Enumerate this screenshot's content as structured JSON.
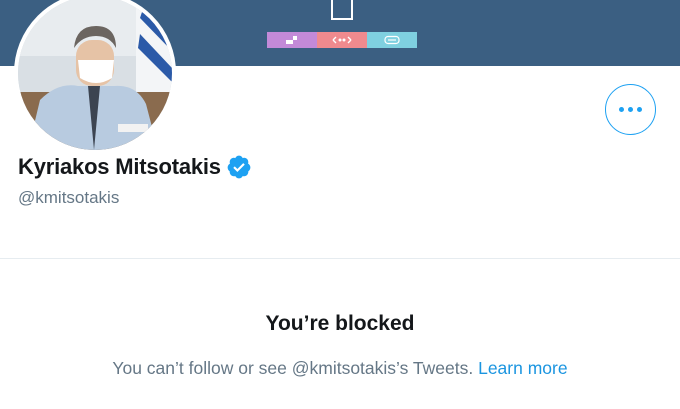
{
  "profile": {
    "display_name": "Kyriakos Mitsotakis",
    "handle": "@kmitsotakis",
    "verified_icon": "verified-badge-icon",
    "avatar_icon": "profile-photo"
  },
  "actions": {
    "more_icon": "more-options-icon"
  },
  "blocked": {
    "title": "You’re blocked",
    "message": "You can’t follow or see @kmitsotakis’s Tweets.",
    "link": "Learn more"
  },
  "colors": {
    "banner": "#3b5f82",
    "accent": "#1da1f2",
    "secondary_text": "#657786",
    "link": "#1b95e0"
  }
}
